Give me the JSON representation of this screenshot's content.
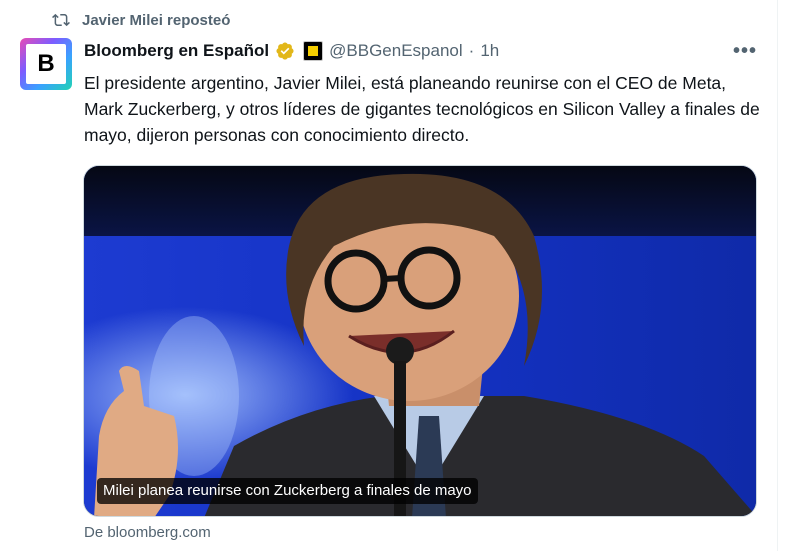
{
  "repost": {
    "icon": "repost-icon",
    "text": "Javier Milei reposteó"
  },
  "author": {
    "avatar_letter": "B",
    "name": "Bloomberg en Español",
    "handle": "@BBGenEspanol",
    "separator": "·",
    "time": "1h",
    "verified_color": "#e2b719"
  },
  "more_label": "•••",
  "tweet": {
    "text": "El presidente argentino, Javier Milei, está planeando reunirse con el CEO de Meta, Mark Zuckerberg, y otros líderes de gigantes tecnológicos en Silicon Valley a finales de mayo, dijeron personas con conocimiento directo."
  },
  "card": {
    "caption": "Milei planea reunirse con Zuckerberg a finales de mayo",
    "source": "De bloomberg.com"
  }
}
